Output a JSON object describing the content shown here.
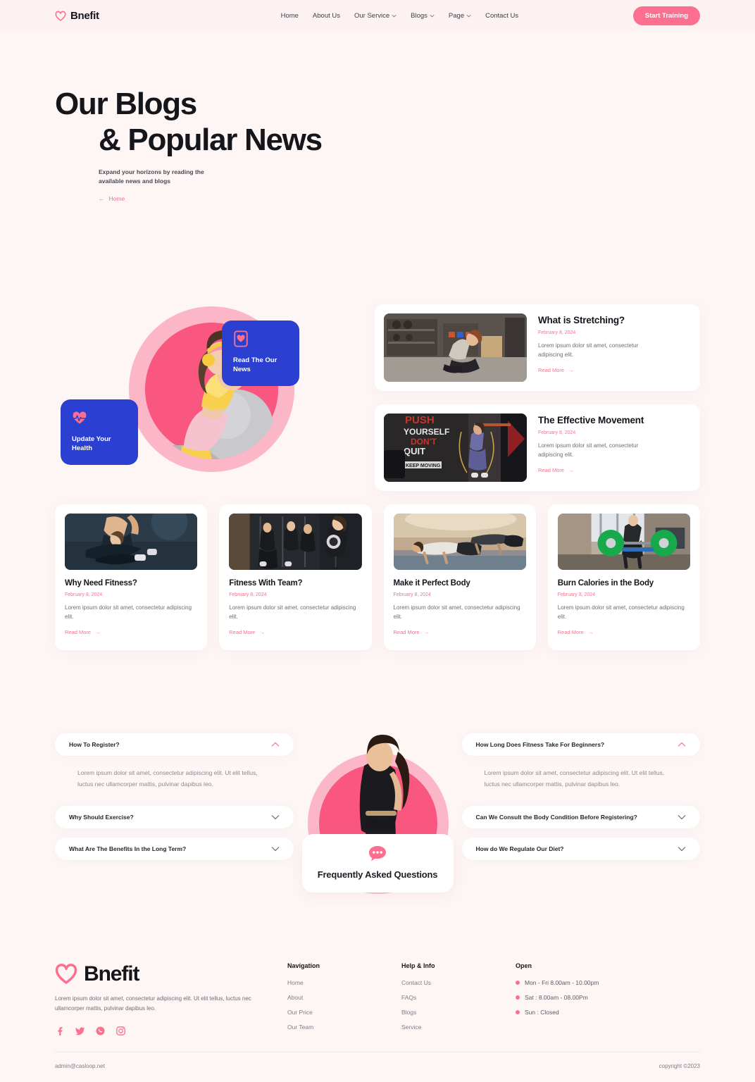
{
  "brand": {
    "name": "Bnefit",
    "heart_icon": "heart-icon"
  },
  "header": {
    "nav": [
      {
        "label": "Home",
        "caret": false
      },
      {
        "label": "About Us",
        "caret": false
      },
      {
        "label": "Our Service",
        "caret": true
      },
      {
        "label": "Blogs",
        "caret": true
      },
      {
        "label": "Page",
        "caret": true
      },
      {
        "label": "Contact Us",
        "caret": false
      }
    ],
    "cta_label": "Start Training"
  },
  "hero": {
    "title_line1": "Our Blogs",
    "title_line2": "& Popular News",
    "subtitle": "Expand your horizons by reading the available news and blogs",
    "breadcrumb_arrow": "←",
    "breadcrumb_label": "Home"
  },
  "featured": {
    "badges": [
      {
        "icon": "mobile-heart-icon",
        "title": "Read The Our News"
      },
      {
        "icon": "heart-pulse-icon",
        "title": "Update Your Health"
      }
    ]
  },
  "wide_cards": [
    {
      "title": "What is Stretching?",
      "date": "February 8, 2024",
      "desc": "Lorem ipsum dolor sit amet, consectetur adipiscing elit.",
      "read_more": "Read More",
      "arrow": "→",
      "image_alt": "woman-stretching-in-gym"
    },
    {
      "title": "The Effective Movement",
      "date": "February 8, 2024",
      "desc": "Lorem ipsum dolor sit amet, consectetur adipiscing elit.",
      "read_more": "Read More",
      "arrow": "→",
      "image_alt": "woman-jump-rope-push-yourself-dont-quit-wall"
    }
  ],
  "grid_cards": [
    {
      "title": "Why Need Fitness?",
      "date": "February 8, 2024",
      "desc": "Lorem ipsum dolor sit amet, consectetur adipiscing elit.",
      "read_more": "Read More",
      "arrow": "→",
      "image_alt": "battle-rope-training"
    },
    {
      "title": "Fitness With Team?",
      "date": "February 8, 2024",
      "desc": "Lorem ipsum dolor sit amet, consectetur adipiscing elit.",
      "read_more": "Read More",
      "arrow": "→",
      "image_alt": "group-training-outdoors"
    },
    {
      "title": "Make it Perfect Body",
      "date": "February 8, 2024",
      "desc": "Lorem ipsum dolor sit amet, consectetur adipiscing elit.",
      "read_more": "Read More",
      "arrow": "→",
      "image_alt": "plank-exercise-class"
    },
    {
      "title": "Burn Calories in the Body",
      "date": "February 8, 2024",
      "desc": "Lorem ipsum dolor sit amet, consectetur adipiscing elit.",
      "read_more": "Read More",
      "arrow": "→",
      "image_alt": "woman-lifting-barbell-green-plates"
    }
  ],
  "faq": {
    "center_title": "Frequently Asked Questions",
    "center_icon": "chat-bubble-icon",
    "left": [
      {
        "question": "How To Register?",
        "open": true,
        "answer": "Lorem ipsum dolor sit amet, consectetur adipiscing elit. Ut elit tellus, luctus nec ullamcorper mattis, pulvinar dapibus leo."
      },
      {
        "question": "Why Should Exercise?",
        "open": false,
        "answer": ""
      },
      {
        "question": "What Are The Benefits In the Long Term?",
        "open": false,
        "answer": ""
      }
    ],
    "right": [
      {
        "question": "How Long Does Fitness Take For Beginners?",
        "open": true,
        "answer": "Lorem ipsum dolor sit amet, consectetur adipiscing elit. Ut elit tellus, luctus nec ullamcorper mattis, pulvinar dapibus leo."
      },
      {
        "question": "Can We Consult the Body Condition Before Registering?",
        "open": false,
        "answer": ""
      },
      {
        "question": "How do We Regulate Our Diet?",
        "open": false,
        "answer": ""
      }
    ]
  },
  "footer": {
    "description": "Lorem ipsum dolor sit amet, consectetur adipiscing elit. Ut elit tellus, luctus nec ullamcorper mattis, pulvinar dapibus leo.",
    "social": [
      "facebook-icon",
      "twitter-icon",
      "whatsapp-icon",
      "instagram-icon"
    ],
    "columns": [
      {
        "heading": "Navigation",
        "links": [
          "Home",
          "About",
          "Our Price",
          "Our Team"
        ]
      },
      {
        "heading": "Help & Info",
        "links": [
          "Contact Us",
          "FAQs",
          "Blogs",
          "Service"
        ]
      }
    ],
    "open_heading": "Open",
    "open_hours": [
      "Mon - Fri 8.00am - 10.00pm",
      "Sat : 8.00am - 08.00Pm",
      "Sun : Closed"
    ],
    "email": "admin@casloop.net",
    "copyright": "copyright ©2023"
  },
  "colors": {
    "accent_pink": "#fc6f8e",
    "deep_pink": "#f9577f",
    "light_pink": "#fbb6c8",
    "badge_blue": "#2b40d0",
    "page_bg": "#fdf6f5"
  }
}
